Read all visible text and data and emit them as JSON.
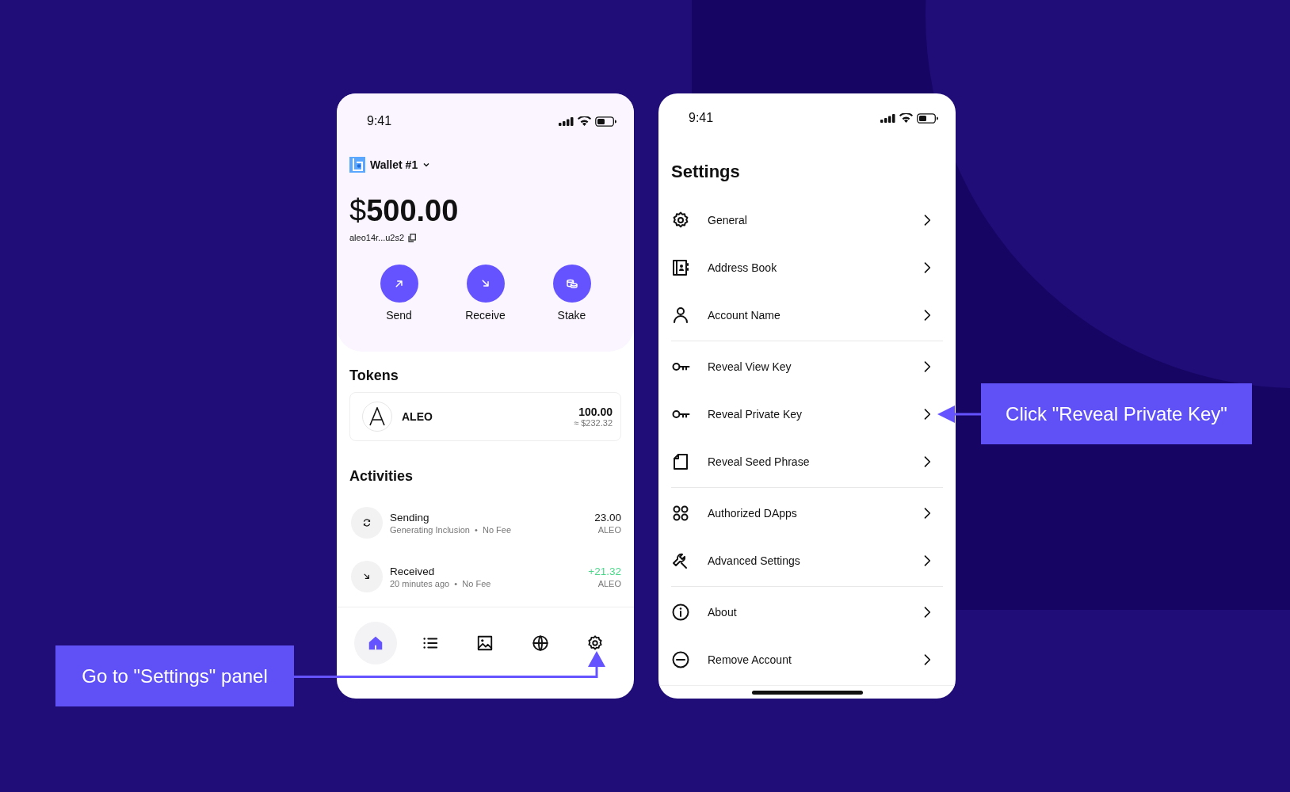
{
  "wallet_screen": {
    "status_time": "9:41",
    "wallet_name": "Wallet #1",
    "balance": "$**500.00**",
    "address": "aleo14r...u2s2",
    "actions": [
      {
        "kind": "send",
        "label": "Send"
      },
      {
        "kind": "receive",
        "label": "Receive"
      },
      {
        "kind": "stake",
        "label": "Stake"
      }
    ],
    "tokens": {
      "title": "Tokens",
      "items": [
        {
          "symbol": "ALEO",
          "amount": "100.00",
          "value": "≈ $232.32"
        }
      ]
    },
    "activities": {
      "title": "Activities",
      "items": [
        {
          "kind": "pending",
          "title": "Sending",
          "detail": "Generating Inclusion  •  No Fee",
          "amount": "23.00",
          "unit": "ALEO"
        },
        {
          "kind": "received",
          "title": "Received",
          "detail": "20 minutes ago  •  No Fee",
          "amount": "+21.32",
          "unit": "ALEO"
        }
      ]
    },
    "nav": [
      {
        "kind": "home",
        "selected": true
      },
      {
        "kind": "list",
        "selected": false
      },
      {
        "kind": "image",
        "selected": false
      },
      {
        "kind": "globe",
        "selected": false
      },
      {
        "kind": "settings",
        "selected": false
      }
    ]
  },
  "settings_screen": {
    "status_time": "9:41",
    "title": "Settings",
    "groups": [
      [
        {
          "kind": "gear",
          "label": "General"
        },
        {
          "kind": "book",
          "label": "Address Book"
        },
        {
          "kind": "person",
          "label": "Account Name"
        }
      ],
      [
        {
          "kind": "key",
          "label": "Reveal View Key"
        },
        {
          "kind": "key",
          "label": "Reveal Private Key"
        },
        {
          "kind": "page",
          "label": "Reveal Seed Phrase"
        }
      ],
      [
        {
          "kind": "apps",
          "label": "Authorized DApps"
        },
        {
          "kind": "wrench",
          "label": "Advanced Settings"
        }
      ],
      [
        {
          "kind": "info",
          "label": "About"
        },
        {
          "kind": "minus",
          "label": "Remove Account"
        }
      ]
    ]
  },
  "callouts": [
    {
      "kind": "left",
      "text": "Go to \"Settings\" panel"
    },
    {
      "kind": "right",
      "text": "Click \"Reveal Private Key\""
    }
  ]
}
